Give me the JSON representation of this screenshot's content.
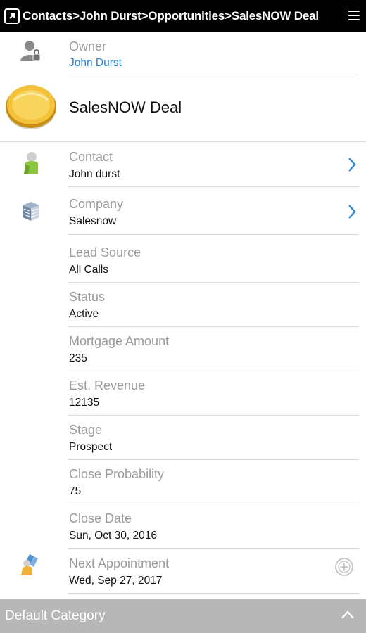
{
  "topbar": {
    "breadcrumb": "Contacts>John Durst>Opportunities>SalesNOW Deal",
    "app_icon": "app-arrow-icon",
    "menu_icon": "hamburger-menu-icon"
  },
  "owner": {
    "label": "Owner",
    "value": "John Durst",
    "icon": "owner-lock-icon"
  },
  "deal": {
    "title": "SalesNOW Deal",
    "icon": "coin-icon"
  },
  "fields": {
    "contact": {
      "label": "Contact",
      "value": "John durst",
      "icon": "contact-person-icon"
    },
    "company": {
      "label": "Company",
      "value": "Salesnow",
      "icon": "company-building-icon"
    },
    "lead_source": {
      "label": "Lead Source",
      "value": "All Calls"
    },
    "status": {
      "label": "Status",
      "value": "Active"
    },
    "mortgage_amount": {
      "label": "Mortgage Amount",
      "value": "235"
    },
    "est_revenue": {
      "label": "Est. Revenue",
      "value": "12135"
    },
    "stage": {
      "label": "Stage",
      "value": "Prospect"
    },
    "close_probability": {
      "label": "Close Probability",
      "value": "75"
    },
    "close_date": {
      "label": "Close Date",
      "value": "Sun, Oct 30, 2016"
    },
    "next_appointment": {
      "label": "Next Appointment",
      "value": "Wed, Sep 27, 2017",
      "icon": "appointment-icon"
    }
  },
  "bottom_bar": {
    "label": "Default Category",
    "icon": "chevron-up-icon"
  },
  "colors": {
    "link": "#2a86d6",
    "chevron": "#2a86d6",
    "topbar": "#000000",
    "bottom_bar": "#b7b7b7"
  }
}
